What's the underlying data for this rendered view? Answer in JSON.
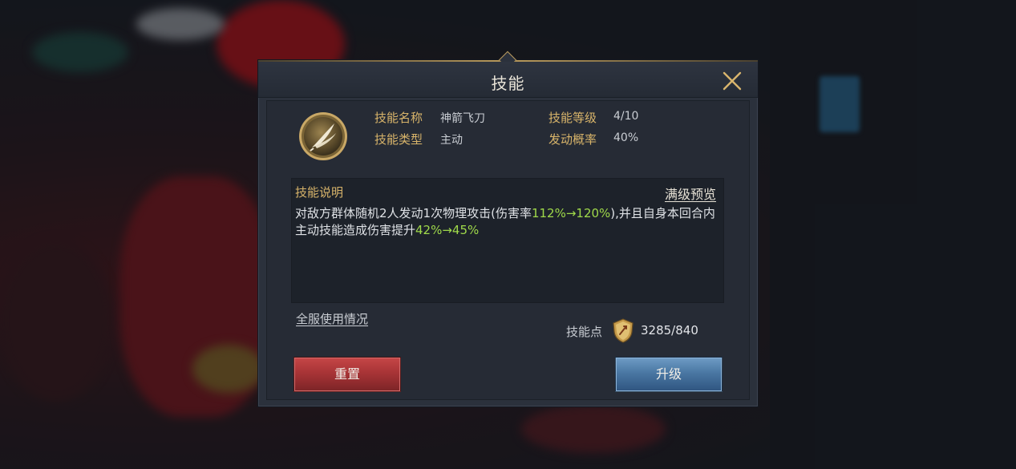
{
  "dialog": {
    "title": "技能",
    "close_icon": "close-icon"
  },
  "skill": {
    "icon": "arrow-skill-icon",
    "name_label": "技能名称",
    "name_value": "神箭飞刀",
    "type_label": "技能类型",
    "type_value": "主动",
    "level_label": "技能等级",
    "level_value": "4/10",
    "chance_label": "发动概率",
    "chance_value": "40%"
  },
  "description": {
    "title": "技能说明",
    "preview_link": "满级预览",
    "text_part1": "对敌方群体随机2人发动1次物理攻击(伤害率",
    "text_hl1": "112%→120%",
    "text_part2": "),并且自身本回合内主动技能造成伤害提升",
    "text_hl2": "42%→45%"
  },
  "footer": {
    "usage_link": "全服使用情况",
    "points_label": "技能点",
    "points_icon": "skill-point-shield-icon",
    "points_value": "3285/840"
  },
  "buttons": {
    "reset": "重置",
    "upgrade": "升级"
  },
  "colors": {
    "gold_label": "#d8b46a",
    "highlight_green": "#9fd94a",
    "reset_red": "#a83436",
    "upgrade_blue": "#4a77a3"
  }
}
